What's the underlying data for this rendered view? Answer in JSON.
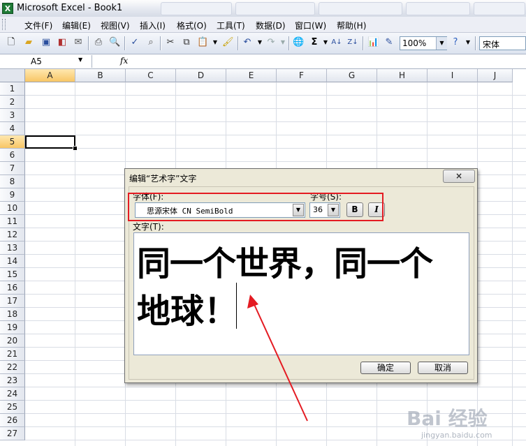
{
  "window": {
    "title": "Microsoft Excel - Book1"
  },
  "menu": {
    "items": [
      "文件(F)",
      "编辑(E)",
      "视图(V)",
      "插入(I)",
      "格式(O)",
      "工具(T)",
      "数据(D)",
      "窗口(W)",
      "帮助(H)"
    ]
  },
  "toolbar": {
    "zoom": "100%",
    "font_name": "宋体"
  },
  "formula_bar": {
    "name_box": "A5",
    "fx": "fx"
  },
  "sheet": {
    "columns": [
      "A",
      "B",
      "C",
      "D",
      "E",
      "F",
      "G",
      "H",
      "I",
      "J"
    ],
    "rows": [
      "1",
      "2",
      "3",
      "4",
      "5",
      "6",
      "7",
      "8",
      "9",
      "10",
      "11",
      "12",
      "13",
      "14",
      "15",
      "16",
      "17",
      "18",
      "19",
      "20",
      "21",
      "22",
      "23",
      "24",
      "25",
      "26",
      "27"
    ],
    "selected_cell": "A5"
  },
  "dialog": {
    "title": "编辑“艺术字”文字",
    "close_label": "×",
    "font_label": "字体(F):",
    "size_label": "字号(S):",
    "font_value": "思源宋体 CN SemiBold",
    "size_value": "36",
    "bold_label": "B",
    "italic_label": "I",
    "text_label": "文字(T):",
    "text_line1": "同一个世界，同一个",
    "text_line2": "地球！",
    "ok_label": "确定",
    "cancel_label": "取消"
  },
  "watermark": {
    "logo": "Bai 经验",
    "url": "jingyan.baidu.com"
  },
  "colors": {
    "annotation": "#e41b22",
    "excel_green": "#1e7a36",
    "active_header": "#f8c666"
  }
}
